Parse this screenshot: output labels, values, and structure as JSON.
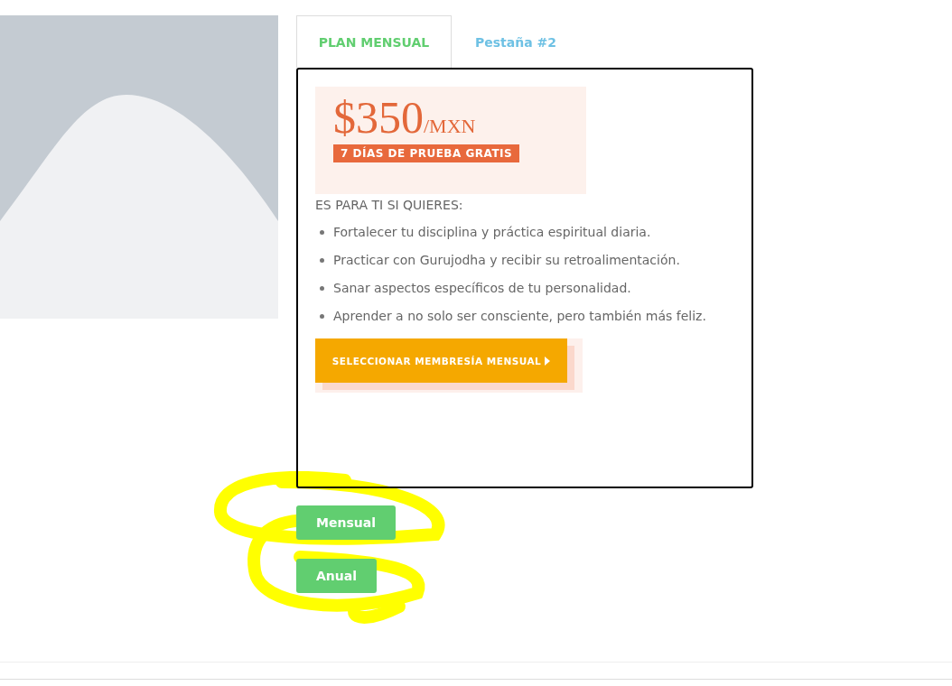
{
  "tabs": [
    {
      "label": "PLAN MENSUAL",
      "selected": true
    },
    {
      "label": "Pestaña #2",
      "selected": false
    }
  ],
  "plan": {
    "price": "$350",
    "currency": "/MXN",
    "trial": "7 DÍAS DE PRUEBA GRATIS",
    "intro": "ES PARA TI SI QUIERES:",
    "benefits": [
      "Fortalecer tu disciplina y práctica espiritual diaria.",
      "Practicar con Gurujodha y recibir su retroalimentación.",
      "Sanar aspectos específicos de tu personalidad.",
      "Aprender a no solo ser consciente, pero también más feliz."
    ],
    "cta": "SELECCIONAR MEMBRESÍA MENSUAL"
  },
  "buttons": [
    "Mensual",
    "Anual"
  ]
}
